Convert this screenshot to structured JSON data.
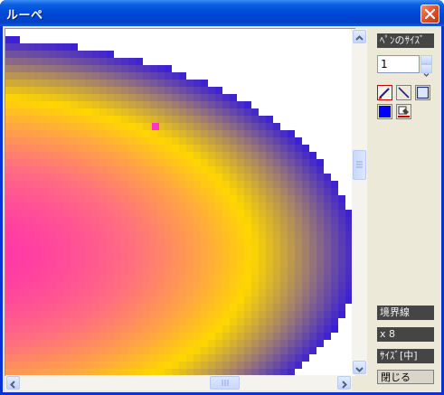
{
  "window": {
    "title": "ルーペ"
  },
  "canvas": {
    "gradient_colors": [
      "#ff33aa",
      "#ff6f80",
      "#ffa840",
      "#ffd700",
      "#a07d70",
      "#3a1fd6"
    ],
    "marker_color": "#ff33cc"
  },
  "side": {
    "pen_size_label": "ﾍﾟﾝのｻｲｽﾞ",
    "pen_size_value": "1",
    "tools": [
      "pencil-tool",
      "line-tool",
      "rectangle-tool",
      "color-swatch",
      "bucket-tool"
    ],
    "swatch_color": "#0000ff",
    "boundary_label": "境界線",
    "zoom_label": "x 8",
    "size_label": "ｻｲｽﾞ[中]",
    "close_label": "閉じる"
  }
}
